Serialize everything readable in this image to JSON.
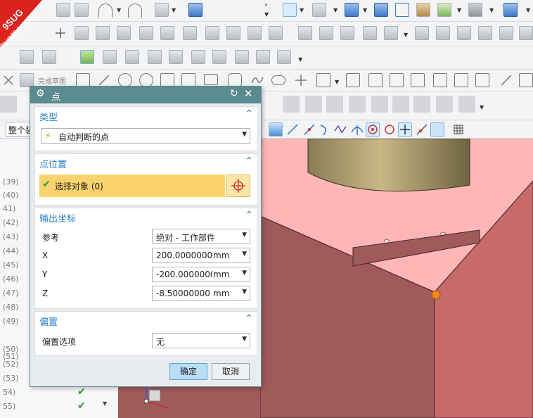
{
  "watermark": {
    "line1": "9SUG",
    "line2": "学UG就上UG网"
  },
  "sketch_toolbar": {
    "finish_sketch": "完成草图"
  },
  "filter": {
    "scope": "整个装"
  },
  "navigator": {
    "rows": [
      "(39)",
      "(40)",
      "41)",
      "(42)",
      "(43)",
      "(44)",
      "(45)",
      "(46)",
      "(47)",
      "(48)",
      "(49)",
      "(50)",
      "(51)",
      "(52)",
      "(53)",
      "54)",
      "55)"
    ]
  },
  "dialog": {
    "title": "点",
    "type_section": {
      "header": "类型",
      "value": "自动判断的点"
    },
    "location_section": {
      "header": "点位置",
      "select_label": "选择对象 (0)"
    },
    "output_section": {
      "header": "输出坐标",
      "reference_label": "参考",
      "reference_value": "绝对 - 工作部件",
      "x_label": "X",
      "x_value": "200.0000000",
      "x_unit": "mm",
      "y_label": "Y",
      "y_value": "-200.0000000",
      "y_unit": "mm",
      "z_label": "Z",
      "z_value": "-8.50000000",
      "z_unit": "mm"
    },
    "offset_section": {
      "header": "偏置",
      "option_label": "偏置选项",
      "option_value": "无"
    },
    "ok_label": "确定",
    "cancel_label": "取消"
  },
  "colors": {
    "title_bar": "#5b8b8f",
    "section_header": "#2a7fbf",
    "selection_bg": "#fad36e",
    "viewport_face": "#ffb6b6",
    "primary_button": "#b9ddf5"
  }
}
